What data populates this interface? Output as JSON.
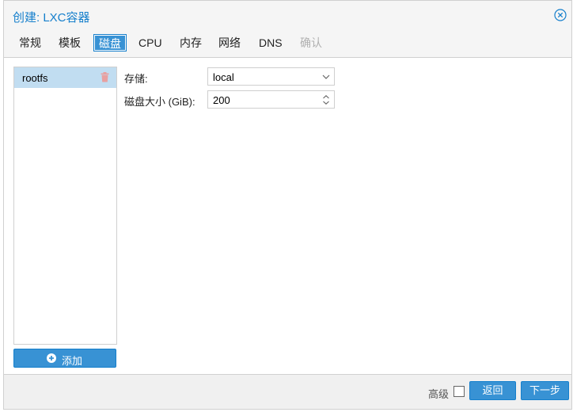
{
  "dialog": {
    "title": "创建: LXC容器",
    "close_icon": "close-circle-icon"
  },
  "tabs": [
    {
      "label": "常规",
      "active": false,
      "disabled": false
    },
    {
      "label": "模板",
      "active": false,
      "disabled": false
    },
    {
      "label": "磁盘",
      "active": true,
      "disabled": false
    },
    {
      "label": "CPU",
      "active": false,
      "disabled": false
    },
    {
      "label": "内存",
      "active": false,
      "disabled": false
    },
    {
      "label": "网络",
      "active": false,
      "disabled": false
    },
    {
      "label": "DNS",
      "active": false,
      "disabled": false
    },
    {
      "label": "确认",
      "active": false,
      "disabled": true
    }
  ],
  "disks": {
    "items": [
      {
        "label": "rootfs",
        "icon": "trash-icon"
      }
    ],
    "add_label": "添加",
    "add_icon": "plus-circle-icon"
  },
  "form": {
    "storage_label": "存储:",
    "storage_value": "local",
    "size_label": "磁盘大小 (GiB):",
    "size_value": "200"
  },
  "footer": {
    "advanced_label": "高级",
    "back_label": "返回",
    "next_label": "下一步"
  },
  "colors": {
    "accent": "#3892d4",
    "title": "#157fcc",
    "selected_row": "#c1ddf1",
    "trash": "#e8a0a0"
  }
}
